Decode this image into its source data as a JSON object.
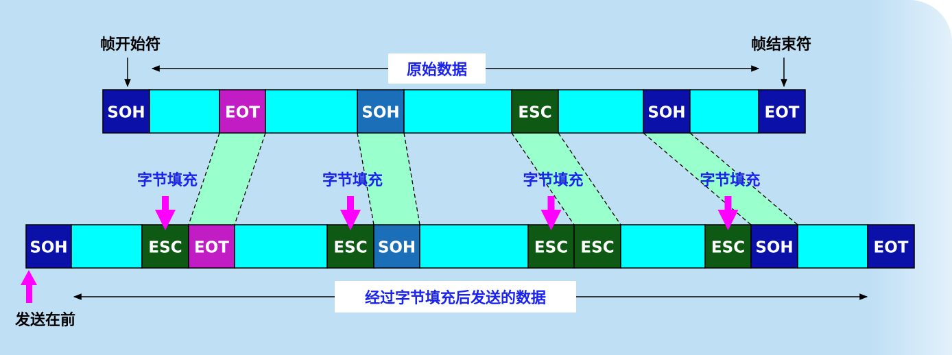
{
  "labels": {
    "frame_start": "帧开始符",
    "frame_end": "帧结束符",
    "original_data": "原始数据",
    "stuffed_data": "经过字节填充后发送的数据",
    "send_first": "发送在前",
    "byte_stuffing": "字节填充"
  },
  "original_frame": {
    "cells": [
      {
        "text": "SOH",
        "kind": "soh"
      },
      {
        "text": "",
        "kind": "data"
      },
      {
        "text": "EOT",
        "kind": "eot-mid"
      },
      {
        "text": "",
        "kind": "data"
      },
      {
        "text": "SOH",
        "kind": "soh-mid"
      },
      {
        "text": "",
        "kind": "data"
      },
      {
        "text": "ESC",
        "kind": "esc"
      },
      {
        "text": "",
        "kind": "data"
      },
      {
        "text": "SOH",
        "kind": "soh"
      },
      {
        "text": "",
        "kind": "data"
      },
      {
        "text": "EOT",
        "kind": "soh"
      }
    ]
  },
  "stuffed_frame": {
    "cells": [
      {
        "text": "SOH",
        "kind": "soh"
      },
      {
        "text": "",
        "kind": "data"
      },
      {
        "text": "ESC",
        "kind": "esc"
      },
      {
        "text": "EOT",
        "kind": "eot-mid"
      },
      {
        "text": "",
        "kind": "data"
      },
      {
        "text": "ESC",
        "kind": "esc"
      },
      {
        "text": "SOH",
        "kind": "soh-mid"
      },
      {
        "text": "",
        "kind": "data"
      },
      {
        "text": "ESC",
        "kind": "esc"
      },
      {
        "text": "ESC",
        "kind": "esc"
      },
      {
        "text": "",
        "kind": "data"
      },
      {
        "text": "ESC",
        "kind": "esc"
      },
      {
        "text": "SOH",
        "kind": "soh"
      },
      {
        "text": "",
        "kind": "data"
      },
      {
        "text": "EOT",
        "kind": "soh"
      }
    ]
  },
  "colors": {
    "background": "#bfdff5",
    "soh": "#0a10a8",
    "soh-mid": "#1a6fb8",
    "eot-mid": "#c21cc4",
    "esc": "#0e5a14",
    "data": "#00ffff",
    "mapping": "#99ffcc",
    "stuff_label": "#1a22ee",
    "arrow_magenta": "#ff00ff",
    "cell_text": "#ffffff"
  }
}
